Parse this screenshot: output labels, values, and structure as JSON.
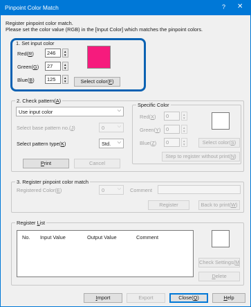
{
  "window": {
    "title": "Pinpoint Color Match",
    "help_glyph": "?",
    "close_glyph": "✕"
  },
  "intro": {
    "line1": "Register pinpoint color match.",
    "line2": "Please set the color value (RGB) in the [Input Color] which matches the pinpoint colors."
  },
  "input_color": {
    "legend": "1. Set input color",
    "red": {
      "label": "Red(",
      "key": "R",
      "value": "246"
    },
    "green": {
      "label": "Green(",
      "key": "G",
      "value": "27"
    },
    "blue": {
      "label": "Blue(",
      "key": "B",
      "value": "125"
    },
    "swatch_color": "#f61b7d",
    "select_color_label": "Select color(",
    "select_color_key": "F"
  },
  "check_pattern": {
    "legend_prefix": "2. Check pattern(",
    "legend_key": "A",
    "mode_value": "Use input color",
    "base_pattern_label": "Select base pattern no.(",
    "base_pattern_key": "J",
    "base_pattern_value": "0",
    "pattern_type_label": "Select pattern type(",
    "pattern_type_key": "K",
    "pattern_type_value": "Std.",
    "print_label_key": "P",
    "print_label_rest": "rint",
    "cancel_label": "Cancel"
  },
  "specific_color": {
    "legend": "Specific Color",
    "red": {
      "label": "Red(",
      "key": "X",
      "value": "0"
    },
    "green": {
      "label": "Green(",
      "key": "Y",
      "value": "0"
    },
    "blue": {
      "label": "Blue(",
      "key": "Z",
      "value": "0"
    },
    "select_color_label": "Select color(",
    "select_color_key": "S",
    "step_label": "Step to register without print(",
    "step_key": "N"
  },
  "register_match": {
    "legend": "3. Register pinpoint color match",
    "registered_color_label": "Registered Color(",
    "registered_color_key": "E",
    "registered_value": "0",
    "comment_label": "Comment",
    "register_button": "Register",
    "back_button": "Back to print(",
    "back_key": "W"
  },
  "register_list": {
    "legend_prefix": "Register ",
    "legend_key": "L",
    "legend_rest": "ist",
    "columns": [
      "No.",
      "Input Value",
      "Output Value",
      "Comment"
    ],
    "check_settings_label": "Check Settings(",
    "check_settings_key": "M",
    "delete_label_key": "D",
    "delete_label_rest": "elete"
  },
  "footer": {
    "import_key": "I",
    "import_rest": "mport",
    "export_label": "Export",
    "close_label": "Close(",
    "close_key": "Q",
    "help_key": "H",
    "help_rest": "elp"
  },
  "colors": {
    "highlight_border": "#0b62b3",
    "titlebar": "#0078d7"
  }
}
